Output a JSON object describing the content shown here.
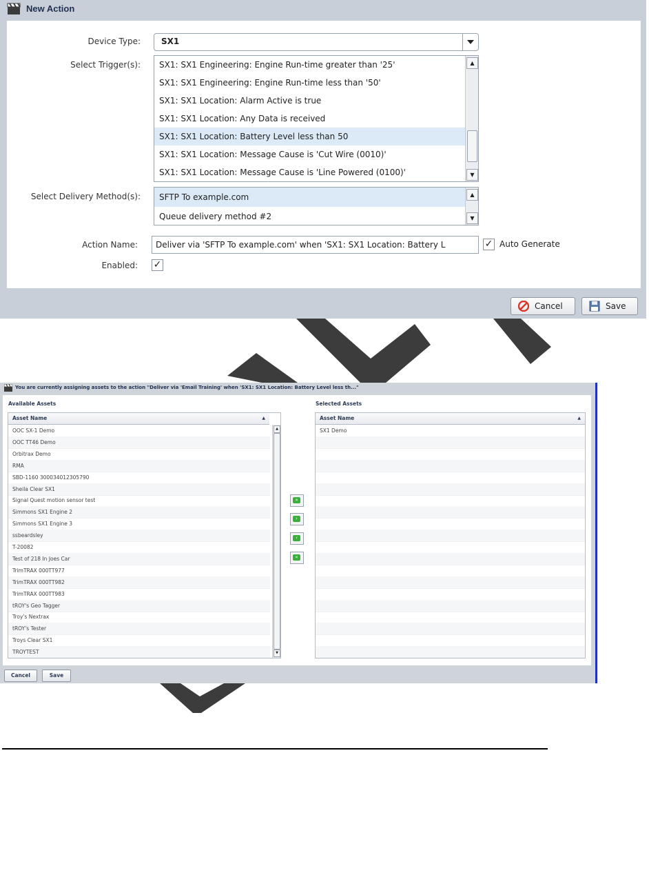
{
  "new_action": {
    "title": "New Action",
    "device_type_label": "Device Type:",
    "device_type_value": "SX1",
    "triggers_label": "Select Trigger(s):",
    "triggers": [
      "SX1: SX1 Engineering: Engine Run-time greater than '25'",
      "SX1: SX1 Engineering: Engine Run-time less than '50'",
      "SX1: SX1 Location: Alarm Active is true",
      "SX1: SX1 Location: Any Data is received",
      "SX1: SX1 Location: Battery Level less than 50",
      "SX1: SX1 Location: Message Cause is 'Cut Wire (0010)'",
      "SX1: SX1 Location: Message Cause is 'Line Powered (0100)'"
    ],
    "selected_trigger_index": 4,
    "delivery_label": "Select Delivery Method(s):",
    "delivery_methods": [
      "SFTP To example.com",
      "Queue delivery method #2"
    ],
    "selected_delivery_index": 0,
    "action_name_label": "Action Name:",
    "action_name_value": "Deliver via 'SFTP To example.com' when 'SX1: SX1 Location: Battery L",
    "auto_generate_label": "Auto Generate",
    "auto_generate_checked": true,
    "enabled_label": "Enabled:",
    "enabled_checked": true,
    "cancel_label": "Cancel",
    "save_label": "Save"
  },
  "assign_assets": {
    "title": "You are currently assigning assets to the action \"Deliver via 'Email Training' when 'SX1: SX1 Location: Battery Level less th...\"",
    "available_label": "Available Assets",
    "selected_label": "Selected Assets",
    "column_header": "Asset Name",
    "available_assets": [
      "OOC SX-1 Demo",
      "OOC TT46 Demo",
      "Orbitrax Demo",
      "RMA",
      "SBD-1160 300034012305790",
      "Sheila Clear SX1",
      "Signal Quest motion sensor test",
      "Simmons SX1 Engine 2",
      "Simmons SX1 Engine 3",
      "ssbeardsley",
      "T-20082",
      "Test of 218 In Joes Car",
      "TrimTRAX 000TT977",
      "TrimTRAX 000TT982",
      "TrimTRAX 000TT983",
      "tROY's Geo Tagger",
      "Troy's Nextrax",
      "tROY's Tester",
      "Troys Clear SX1",
      "TROYTEST"
    ],
    "selected_assets": [
      "SX1 Demo"
    ],
    "cancel_label": "Cancel",
    "save_label": "Save"
  },
  "colors": {
    "selection": "#dce9f7",
    "dialog_frame": "#c9cfd8",
    "mark": "#3c3c3c",
    "accent_blue": "#1f2fc0",
    "move_button_green": "#3cae3c",
    "cancel_icon_red": "#d9362a"
  },
  "icons": {
    "dialog_icon": "clapperboard-icon",
    "cancel_icon": "no-entry-icon",
    "save_icon": "floppy-disk-icon"
  }
}
